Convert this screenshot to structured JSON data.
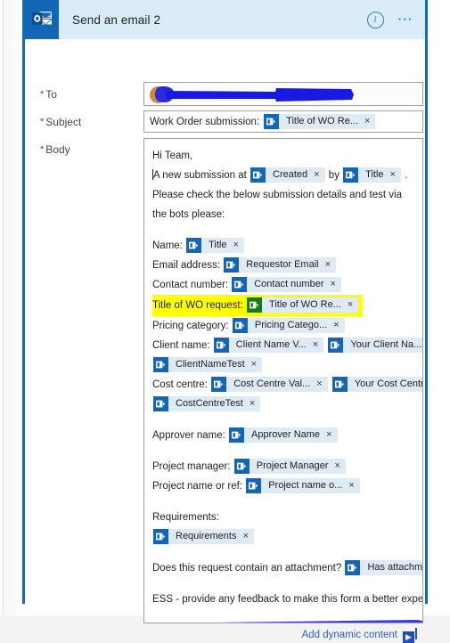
{
  "header": {
    "title": "Send an email 2",
    "app_icon": "outlook-icon",
    "info_icon": "info-icon",
    "more_icon": "more-options-icon",
    "accent": "#1266b5",
    "header_bg": "#d9ecf8"
  },
  "fields": {
    "to": {
      "label": "To",
      "required": true,
      "value": "",
      "redacted": true
    },
    "subject": {
      "label": "Subject",
      "required": true,
      "text": "Work Order submission:",
      "chip": {
        "label": "Title of WO Re...",
        "close": "×"
      }
    },
    "body": {
      "label": "Body",
      "required": true
    }
  },
  "body_content": {
    "greeting": "Hi Team,",
    "intro_pre": "A new submission at",
    "intro_mid": "by",
    "intro_post": ". Please check the below submission details and test via the bots please:",
    "chip_created": {
      "label": "Created",
      "close": "×"
    },
    "chip_title_by": {
      "label": "Title",
      "close": "×"
    },
    "rows": [
      {
        "label": "Name:",
        "highlight": false,
        "chips": [
          {
            "label": "Title",
            "close": "×"
          }
        ]
      },
      {
        "label": "Email address:",
        "highlight": false,
        "chips": [
          {
            "label": "Requestor Email",
            "close": "×"
          }
        ]
      },
      {
        "label": "Contact number:",
        "highlight": false,
        "chips": [
          {
            "label": "Contact number",
            "close": "×"
          }
        ]
      },
      {
        "label": "Title of WO request:",
        "highlight": true,
        "chips": [
          {
            "label": "Title of WO Re...",
            "close": "×"
          }
        ]
      },
      {
        "label": "Pricing category:",
        "highlight": false,
        "chips": [
          {
            "label": "Pricing Catego...",
            "close": "×"
          }
        ]
      },
      {
        "label": "Client name:",
        "highlight": false,
        "chips": [
          {
            "label": "Client Name V...",
            "close": "×"
          },
          {
            "label": "Your Client Na...",
            "close": "×"
          },
          {
            "label": "ClientNameTest",
            "close": "×",
            "wrap_before": true
          }
        ]
      },
      {
        "label": "Cost centre:",
        "highlight": false,
        "chips": [
          {
            "label": "Cost Centre Val...",
            "close": "×"
          },
          {
            "label": "Your Cost Centre",
            "close": "×"
          },
          {
            "label": "CostCentreTest",
            "close": "×",
            "wrap_before": true
          }
        ]
      },
      {
        "label": "Approver name:",
        "highlight": false,
        "space_before": true,
        "chips": [
          {
            "label": "Approver Name",
            "close": "×"
          }
        ]
      },
      {
        "label": "Project manager:",
        "highlight": false,
        "space_before": true,
        "chips": [
          {
            "label": "Project Manager",
            "close": "×"
          }
        ]
      },
      {
        "label": "Project name or ref:",
        "highlight": false,
        "chips": [
          {
            "label": "Project name o...",
            "close": "×"
          }
        ]
      },
      {
        "label": "Requirements:",
        "highlight": false,
        "space_before": true,
        "chips": [
          {
            "label": "Requirements",
            "close": "×",
            "wrap_before": true
          }
        ]
      },
      {
        "label": "Does this request contain an attachment?",
        "highlight": false,
        "space_before": true,
        "chips": [
          {
            "label": "Has attachments",
            "close": "×"
          }
        ]
      }
    ],
    "feedback_line": "ESS - provide any feedback to make this form a better experience:",
    "feedback_value": "",
    "feedback_redacted": true
  },
  "footer": {
    "add_dynamic_content": "Add dynamic content",
    "badge_icon": "insert-token-icon"
  },
  "colors": {
    "chip_bg": "#deeaf4",
    "chip_icon": "#1266b5",
    "chip_icon_highlighted": "#167a16",
    "highlight": "#ffff00",
    "link": "#2b5fc9",
    "required": "#a4262c",
    "card_border": "#0f6cbd",
    "redaction": "#2b2bdd"
  }
}
